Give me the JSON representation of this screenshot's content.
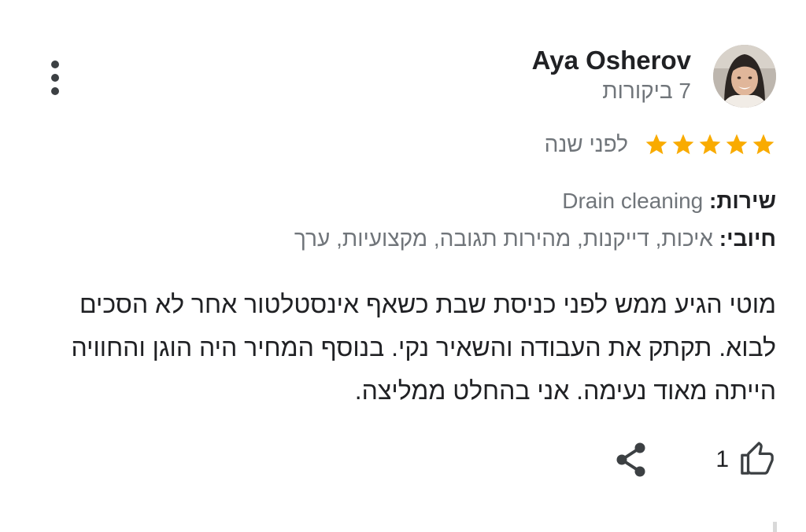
{
  "review": {
    "author": {
      "name": "Aya Osherov",
      "review_count": "7 ביקורות",
      "avatar_icon": "user-avatar-photo"
    },
    "rating": {
      "stars": 5,
      "max_stars": 5,
      "star_color": "#f9ab00"
    },
    "time_ago": "לפני שנה",
    "services": {
      "label": "שירות:",
      "value": "Drain cleaning"
    },
    "positives": {
      "label": "חיובי:",
      "value": "איכות, דייקנות, מהירות תגובה, מקצועיות, ערך"
    },
    "text": "מוטי הגיע ממש לפני כניסת שבת כשאף אינסטלטור אחר לא הסכים לבוא. תקתק את העבודה והשאיר נקי. בנוסף המחיר היה הוגן והחוויה הייתה מאוד נעימה. אני בהחלט ממליצה.",
    "actions": {
      "like_count": "1",
      "like_icon": "thumbs-up-icon",
      "share_icon": "share-icon",
      "more_icon": "more-vertical-icon"
    }
  },
  "colors": {
    "primary_text": "#202124",
    "secondary_text": "#70757a",
    "icon": "#3c4043"
  }
}
